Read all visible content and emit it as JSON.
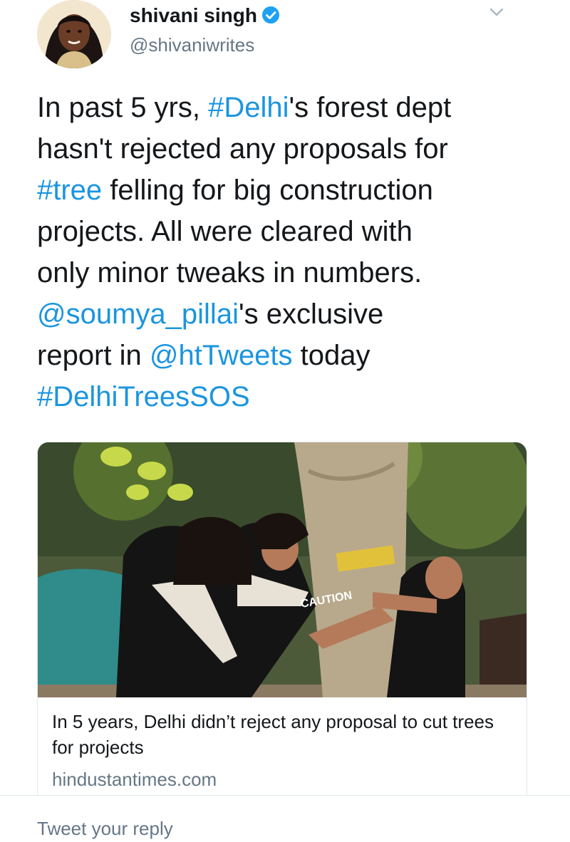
{
  "author": {
    "display_name": "shivani singh",
    "handle": "@shivaniwrites",
    "verified": true,
    "avatar_icon": "profile-photo"
  },
  "tweet": {
    "lines": [
      [
        {
          "text": "In past 5 yrs, "
        },
        {
          "text": "#Delhi",
          "link": true
        },
        {
          "text": "'s forest dept"
        }
      ],
      [
        {
          "text": "hasn't rejected any proposals for"
        }
      ],
      [
        {
          "text": "#tree",
          "link": true
        },
        {
          "text": " felling for big construction"
        }
      ],
      [
        {
          "text": "projects. All were cleared with"
        }
      ],
      [
        {
          "text": "only minor tweaks in numbers."
        }
      ],
      [
        {
          "text": "@soumya_pillai",
          "link": true
        },
        {
          "text": "'s exclusive"
        }
      ],
      [
        {
          "text": "report in "
        },
        {
          "text": "@htTweets",
          "link": true
        },
        {
          "text": " today"
        }
      ],
      [
        {
          "text": "#DelhiTreesSOS",
          "link": true
        }
      ]
    ]
  },
  "card": {
    "image_label": "CAUTION",
    "title": "In 5 years, Delhi didn’t reject any proposal to cut trees for projects",
    "domain": "hindustantimes.com"
  },
  "reply": {
    "placeholder": "Tweet your reply"
  },
  "colors": {
    "link": "#1b95e0",
    "secondary_text": "#657786",
    "border": "#e1e8ed",
    "verified_badge": "#1da1f2"
  },
  "icons": {
    "verified": "verified-badge-icon",
    "menu": "chevron-down-icon"
  }
}
